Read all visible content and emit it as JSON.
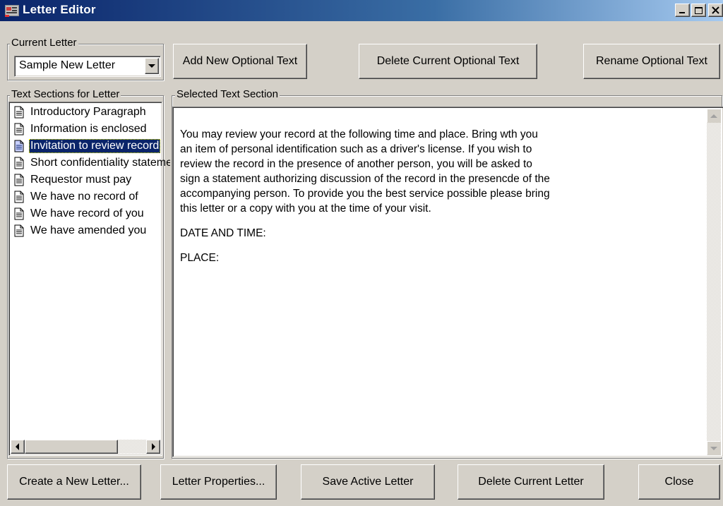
{
  "window": {
    "title": "Letter Editor",
    "controls": [
      "minimize",
      "maximize",
      "close"
    ]
  },
  "current_letter": {
    "legend": "Current Letter",
    "selected_value": "Sample New Letter"
  },
  "toolbar": {
    "add_optional": "Add New Optional Text",
    "delete_optional": "Delete Current Optional Text",
    "rename_optional": "Rename Optional Text"
  },
  "sections": {
    "legend": "Text Sections for Letter",
    "items": [
      {
        "label": "Introductory Paragraph"
      },
      {
        "label": "Information is enclosed"
      },
      {
        "label": "Invitation to review record"
      },
      {
        "label": "Short confidentiality statement"
      },
      {
        "label": "Requestor must pay"
      },
      {
        "label": "We have no record of"
      },
      {
        "label": "We have record of you"
      },
      {
        "label": "We have amended you"
      }
    ],
    "selected_index": 2
  },
  "selected_section": {
    "legend": "Selected Text Section",
    "paragraphs": [
      "You may review your record at the following time and place.  Bring wth you\nan item of personal identification such as a driver's license.  If you wish to\nreview the record in the presence of another person, you will be asked to\nsign a statement authorizing discussion of the record in the presencde of the\naccompanying person.  To provide you the best service possible please bring\nthis letter or a copy with you at the time of your visit.",
      "DATE AND TIME:",
      "PLACE:"
    ]
  },
  "footer": {
    "create_letter": "Create a New Letter...",
    "letter_properties": "Letter Properties...",
    "save_letter": "Save Active Letter",
    "delete_letter": "Delete Current Letter",
    "close": "Close"
  },
  "colors": {
    "face": "#d4d0c8",
    "title_start": "#0a246a",
    "title_end": "#a6caf0",
    "selection": "#0a246a"
  },
  "icons": {
    "title": "letter-editor-app-icon",
    "list_item": "document-icon"
  }
}
